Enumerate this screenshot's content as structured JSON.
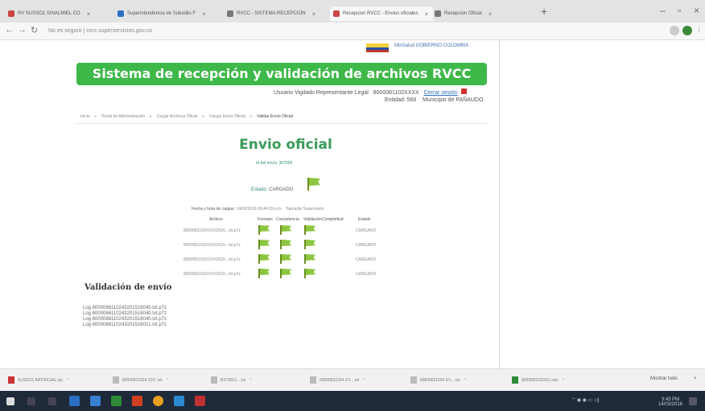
{
  "browser": {
    "tabs": [
      {
        "label": "RV SUSSO1 SINALMIEL CO",
        "color": "#c44"
      },
      {
        "label": "Superintendencia de Subsidio F",
        "color": "#2a6fc1"
      },
      {
        "label": "RVCC - SISTEMA RECEPCION",
        "color": "#777"
      },
      {
        "label": "Recepcion RVCC - Envios oficiales",
        "color": "#c44"
      },
      {
        "label": "Recepcion Oficial",
        "color": "#777"
      }
    ],
    "url": "No es seguro | rvcc.superservicios.gov.co"
  },
  "header": {
    "gov_text": "MinSalud  GOBIERNO  COLOMBIA",
    "banner_title": "Sistema de recepción y validación de archivos RVCC",
    "user_label": "Usuario Vigilado Representante Legal",
    "user_id": "8000081102XXXX",
    "logout_label": "Cerrar sesión",
    "entity_label": "Entidad: 568",
    "municipality": "Municipio de PAÑAUDO"
  },
  "breadcrumb": [
    "Inicio",
    "Portal de Administración",
    "Cargar Archivos Oficial",
    "Cargar Envío Oficial",
    "Validar Envío Oficial"
  ],
  "main": {
    "title": "Envio oficial",
    "id_envio": "Id del envío: 307026",
    "estado_label": "Estado:",
    "estado_value": "CARGADO",
    "fecha_label": "Fecha y hora de cargue:",
    "fecha_value": "14/03/2016 09:44:39 p.m.",
    "tipo_label": "Tipo/a/de Supervisión",
    "columns": [
      "Archivo",
      "Formato",
      "Consistencia",
      "Validación",
      "Completitud",
      "Estado"
    ],
    "rows": [
      {
        "file": "8000081102XXXX2016...txt.p7z",
        "status": "CARGADO"
      },
      {
        "file": "8000081102XXXX2016...txt.p7z",
        "status": "CARGADO"
      },
      {
        "file": "8000081102XXXX2016...txt.p7z",
        "status": "CARGADO"
      },
      {
        "file": "8000081102XXXX2016...txt.p7z",
        "status": "CARGADO"
      }
    ]
  },
  "validation": {
    "title": "Validación de envío",
    "logs": [
      "Log 8000086110243201516040.txt.p7z",
      "Log 8000086110243201516040.txt.p7z",
      "Log 8000086110243201516040.txt.p7z",
      "Log 8000086110243201516021.txt.p7z"
    ]
  },
  "downloads": {
    "items": [
      {
        "label": "SUSSO1 ARTIFICIAL.zip",
        "color": "#c33"
      },
      {
        "label": "80000811024 12/1 .txt",
        "color": "#bbb"
      },
      {
        "label": "BXT0011 ...txt",
        "color": "#bbb"
      },
      {
        "label": "50000811024 2/1 ...txt",
        "color": "#bbb"
      },
      {
        "label": "80000811024 2/1 ...txt",
        "color": "#bbb"
      },
      {
        "label": "8000081102412.xlsx",
        "color": "#2f8a3a"
      }
    ],
    "show_all": "Mostrar todo"
  },
  "taskbar": {
    "clock": "3:43 PM",
    "date": "14/03/2016"
  }
}
